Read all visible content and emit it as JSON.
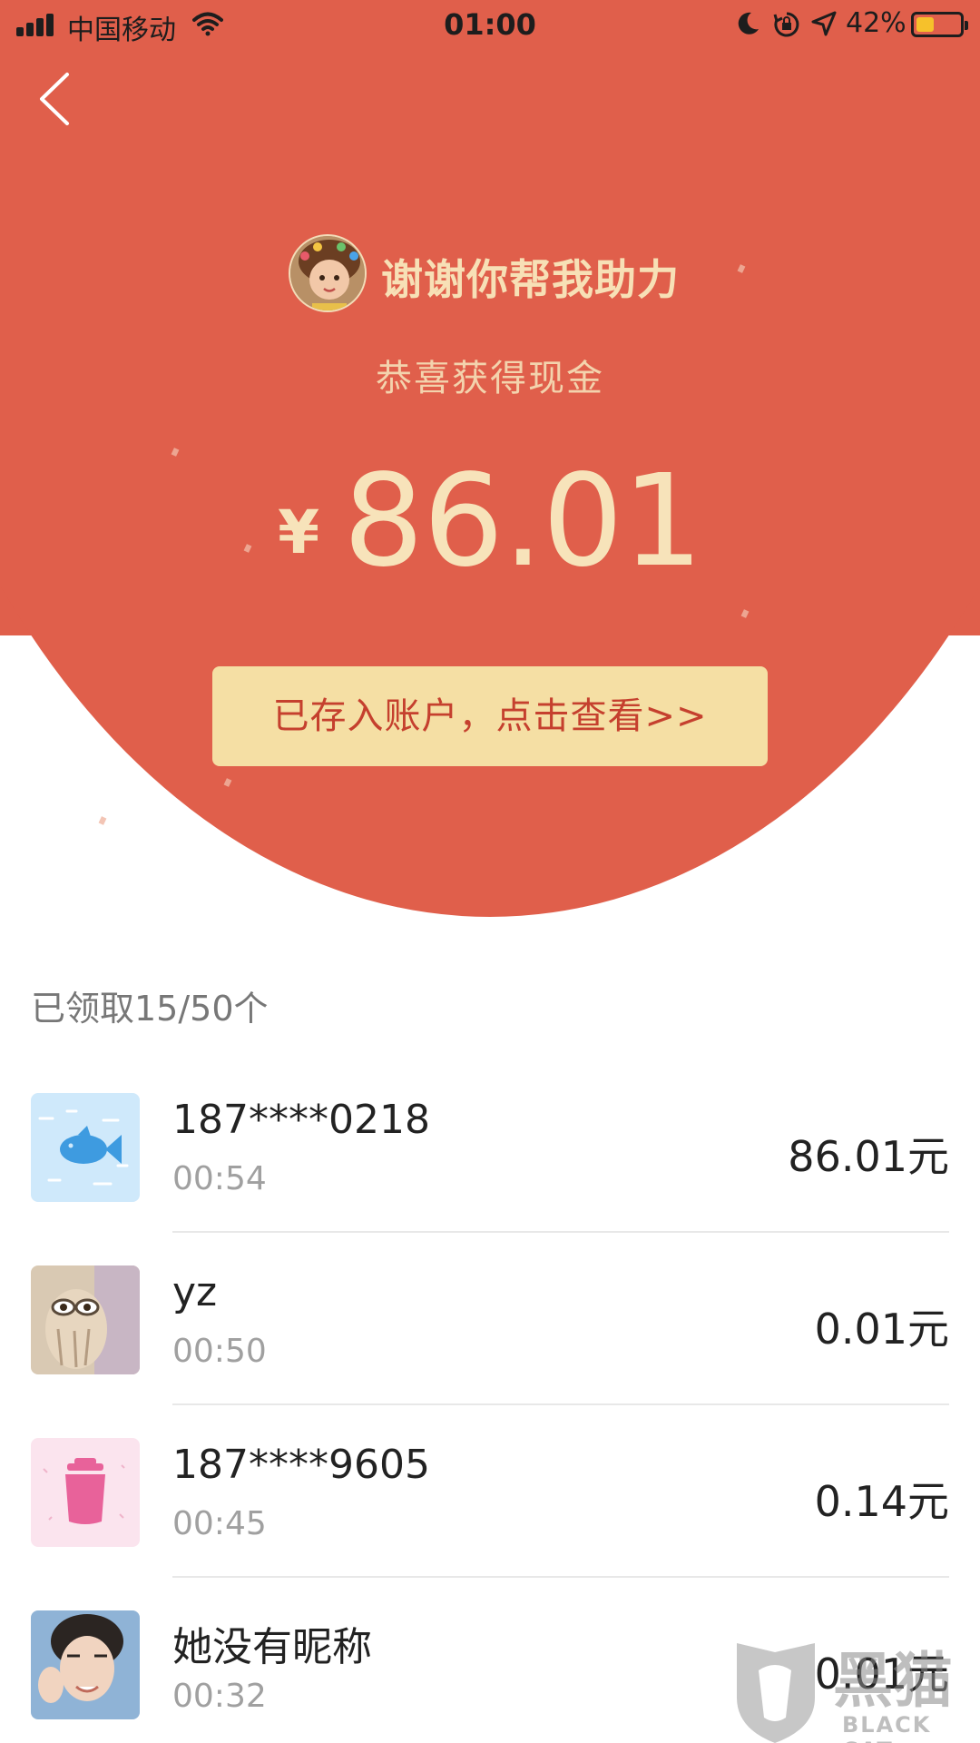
{
  "status_bar": {
    "carrier": "中国移动",
    "time": "01:00",
    "battery_percent": "42%",
    "battery_level": 0.42,
    "battery_color": "#f6c12b",
    "icons": [
      "signal-icon",
      "wifi-icon",
      "moon-icon",
      "rotation-lock-icon",
      "location-arrow-icon",
      "battery-icon"
    ]
  },
  "header": {
    "back_icon": "chevron-left-icon",
    "thanks_text": "谢谢你帮我助力",
    "congrats_text": "恭喜获得现金",
    "currency_symbol": "¥",
    "amount": "86.01",
    "view_button_label": "已存入账户，点击查看>>"
  },
  "claims": {
    "count_label": "已领取15/50个",
    "items": [
      {
        "name": "187****0218",
        "time": "00:54",
        "amount": "86.01元",
        "avatar": "blue-fish-avatar"
      },
      {
        "name": "yz",
        "time": "00:50",
        "amount": "0.01元",
        "avatar": "photo-avatar"
      },
      {
        "name": "187****9605",
        "time": "00:45",
        "amount": "0.14元",
        "avatar": "pink-jar-avatar"
      },
      {
        "name": "她没有昵称",
        "time": "00:32",
        "amount": "0.01元",
        "avatar": "person-photo-avatar"
      }
    ]
  },
  "watermark": {
    "text": "黑猫",
    "subtext": "BLACK CAT"
  },
  "colors": {
    "header_red": "#e05f4b",
    "gold_text": "#f7e3ba",
    "button_bg": "#f5dfa4",
    "button_text": "#c5402e"
  }
}
